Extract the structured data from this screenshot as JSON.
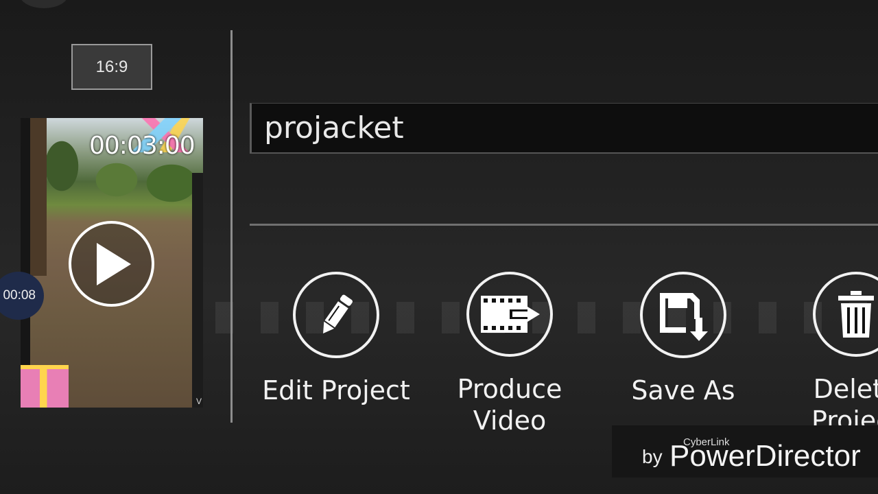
{
  "aspect_ratio": {
    "label": "16:9"
  },
  "clip": {
    "timecode": "00:03:00",
    "duration": "00:08"
  },
  "project": {
    "name": "projacket"
  },
  "actions": [
    {
      "label": "Edit Project",
      "icon": "pencil-icon"
    },
    {
      "label": "Produce\nVideo",
      "icon": "produce-video-icon"
    },
    {
      "label": "Save As",
      "icon": "save-as-icon"
    },
    {
      "label": "Delete\nProject",
      "icon": "trash-icon"
    }
  ],
  "branding": {
    "maker": "CyberLink",
    "by": "by",
    "product": "PowerDirector"
  },
  "colors": {
    "background": "#202020",
    "accent_badge": "#1f2b4a",
    "foreground": "#f2f2f2"
  }
}
